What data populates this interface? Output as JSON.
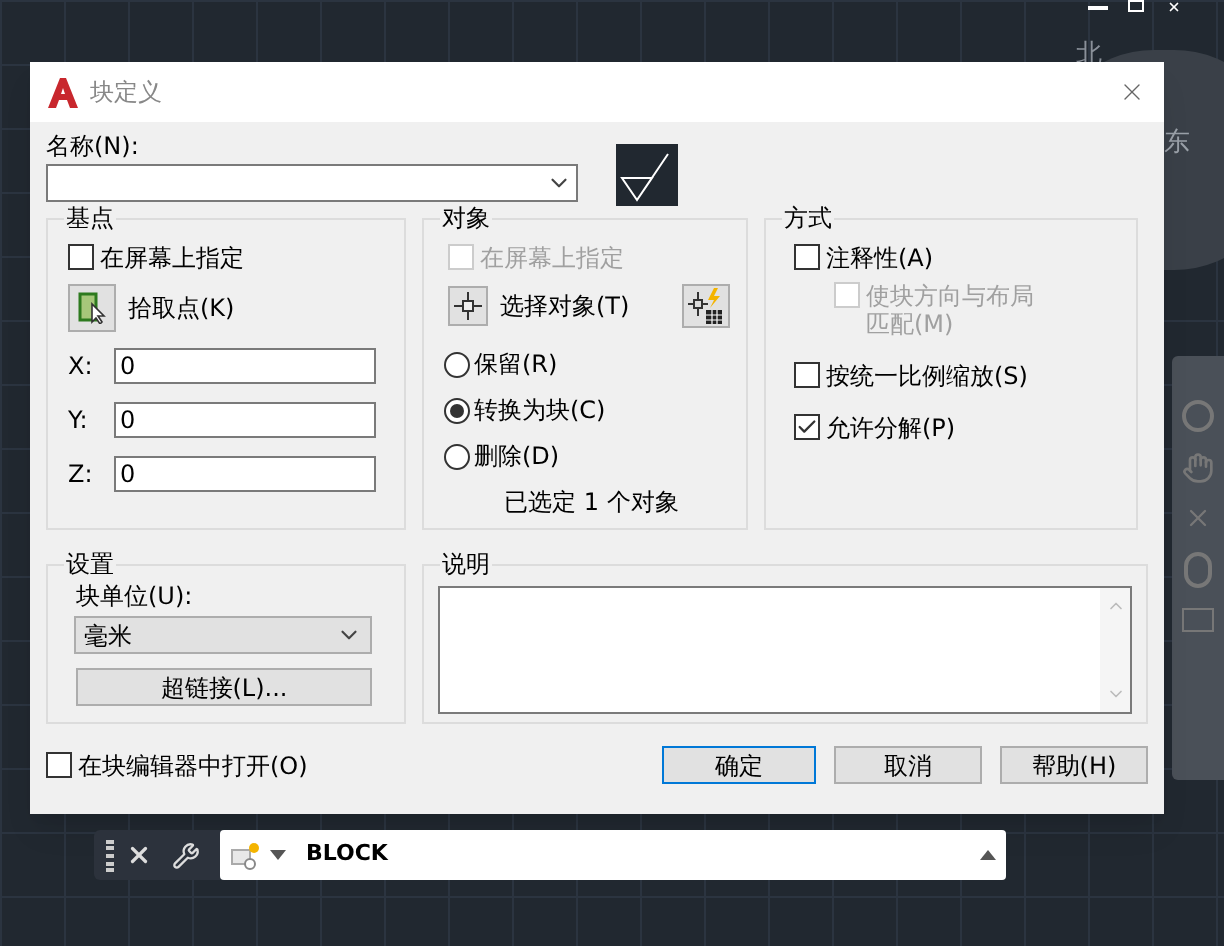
{
  "window": {
    "title": "块定义"
  },
  "viewcube": {
    "labels": [
      "北",
      "东"
    ]
  },
  "name_field": {
    "label": "名称(N):"
  },
  "base_point": {
    "title": "基点",
    "specify_on_screen": {
      "label": "在屏幕上指定",
      "checked": false,
      "disabled": false
    },
    "pick_button": "拾取点(K)",
    "coords": [
      {
        "label": "X:",
        "value": "0"
      },
      {
        "label": "Y:",
        "value": "0"
      },
      {
        "label": "Z:",
        "value": "0"
      }
    ]
  },
  "objects": {
    "title": "对象",
    "specify_on_screen": {
      "label": "在屏幕上指定",
      "checked": false,
      "disabled": true
    },
    "select_button": "选择对象(T)",
    "options": [
      {
        "label": "保留(R)",
        "selected": false
      },
      {
        "label": "转换为块(C)",
        "selected": true
      },
      {
        "label": "删除(D)",
        "selected": false
      }
    ],
    "status": "已选定 1 个对象"
  },
  "behavior": {
    "title": "方式",
    "options": [
      {
        "label": "注释性(A)",
        "checked": false,
        "disabled": false,
        "children": [
          {
            "label": "使块方向与布局匹配(M)",
            "checked": false,
            "disabled": true
          }
        ]
      },
      {
        "label": "按统一比例缩放(S)",
        "checked": false,
        "disabled": false
      },
      {
        "label": "允许分解(P)",
        "checked": true,
        "disabled": false
      }
    ]
  },
  "settings": {
    "title": "设置",
    "unit_label": "块单位(U):",
    "unit_value": "毫米",
    "hyperlink_button": "超链接(L)..."
  },
  "description": {
    "title": "说明"
  },
  "open_in_editor": {
    "label": "在块编辑器中打开(O)",
    "checked": false,
    "disabled": false
  },
  "buttons": [
    {
      "label": "确定",
      "default": true
    },
    {
      "label": "取消",
      "default": false
    },
    {
      "label": "帮助(H)",
      "default": false
    }
  ],
  "command_line": {
    "value": "BLOCK"
  }
}
